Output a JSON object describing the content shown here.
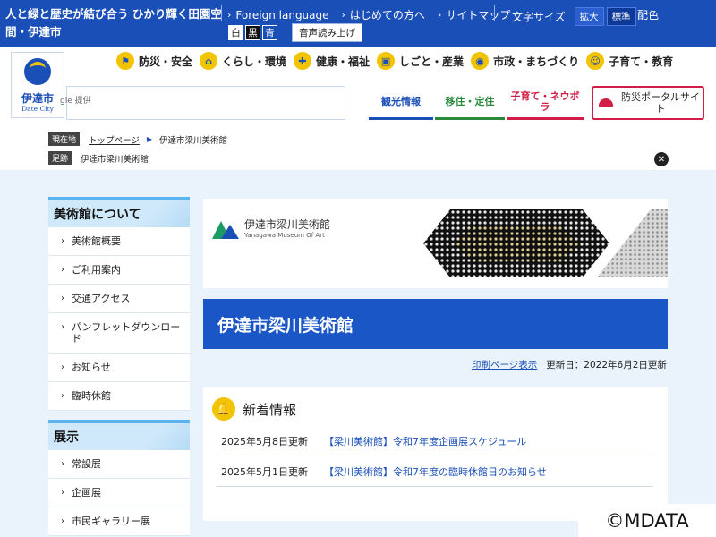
{
  "header": {
    "tagline": "人と緑と歴史が結び合う ひかり輝く田園空間・伊達市",
    "links": [
      {
        "label": "Foreign language"
      },
      {
        "label": "はじめての方へ"
      },
      {
        "label": "サイトマップ"
      }
    ],
    "font_size_label": "文字サイズ",
    "font_size_large": "拡大",
    "font_size_standard": "標準",
    "color_label": "配色",
    "color_options": [
      "白",
      "黒",
      "青"
    ],
    "tts_label": "音声読み上げ"
  },
  "logo": {
    "name": "伊達市",
    "sub": "Date City"
  },
  "gnav": [
    {
      "label": "防災・安全",
      "icon": "flag-icon",
      "glyph": "⚑"
    },
    {
      "label": "くらし・環境",
      "icon": "home-icon",
      "glyph": "⌂"
    },
    {
      "label": "健康・福祉",
      "icon": "health-icon",
      "glyph": "✚"
    },
    {
      "label": "しごと・産業",
      "icon": "briefcase-icon",
      "glyph": "▣"
    },
    {
      "label": "市政・まちづくり",
      "icon": "city-icon",
      "glyph": "◉"
    },
    {
      "label": "子育て・教育",
      "icon": "child-icon",
      "glyph": "☺"
    }
  ],
  "search": {
    "provider_text": "gle 提供"
  },
  "quick": {
    "tourism": "観光情報",
    "relocation": "移住・定住",
    "childcare": "子育て・ネウボラ",
    "disaster": "防災ポータルサイト"
  },
  "breadcrumb": {
    "current_tag": "現在地",
    "home": "トップページ",
    "current": "伊達市梁川美術館",
    "trail_tag": "足跡",
    "trail": "伊達市梁川美術館"
  },
  "sidebar": {
    "about_title": "美術館について",
    "about_items": [
      "美術館概要",
      "ご利用案内",
      "交通アクセス",
      "パンフレットダウンロード",
      "お知らせ",
      "臨時休館"
    ],
    "exhibit_title": "展示",
    "exhibit_items": [
      "常設展",
      "企画展",
      "市民ギャラリー展"
    ]
  },
  "museum_logo": {
    "name": "伊達市梁川美術館",
    "sub": "Yanagawa Museum Of Art"
  },
  "page": {
    "title": "伊達市梁川美術館",
    "print_link": "印刷ページ表示",
    "updated": "更新日：2022年6月2日更新"
  },
  "news": {
    "title": "新着情報",
    "items": [
      {
        "date": "2025年5月8日更新",
        "title": "【梁川美術館】令和7年度企画展スケジュール"
      },
      {
        "date": "2025年5月1日更新",
        "title": "【梁川美術館】令和7年度の臨時休館日のお知らせ"
      }
    ]
  },
  "credit": "©MDATA",
  "colors": {
    "primary": "#1b4fb8",
    "accent": "#f2c400",
    "green": "#2a8a3c",
    "red": "#d21e46"
  }
}
